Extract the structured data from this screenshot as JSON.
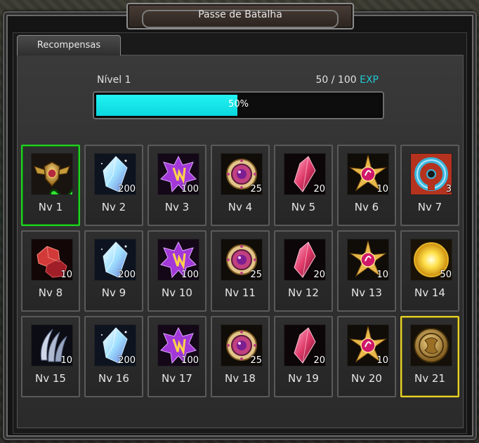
{
  "window": {
    "title": "Passe de Batalha"
  },
  "tabs": [
    {
      "label": "Recompensas"
    }
  ],
  "progress": {
    "level_label": "Nível 1",
    "exp_text": "50 / 100",
    "exp_unit": "EXP",
    "percent_label": "50%",
    "fraction": 0.5
  },
  "rewards": [
    {
      "label": "Nv 1",
      "qty": "",
      "icon": "winged-shield-badge-icon",
      "state": "claimed"
    },
    {
      "label": "Nv 2",
      "qty": "200",
      "icon": "crystal-shard-icon",
      "state": ""
    },
    {
      "label": "Nv 3",
      "qty": "100",
      "icon": "purple-star-rune-icon",
      "state": ""
    },
    {
      "label": "Nv 4",
      "qty": "25",
      "icon": "gold-ring-gem-icon",
      "state": ""
    },
    {
      "label": "Nv 5",
      "qty": "20",
      "icon": "pink-gem-icon",
      "state": ""
    },
    {
      "label": "Nv 6",
      "qty": "10",
      "icon": "star-compass-icon",
      "state": ""
    },
    {
      "label": "Nv 7",
      "qty": "3",
      "icon": "horseshoe-icon",
      "state": ""
    },
    {
      "label": "Nv 8",
      "qty": "10",
      "icon": "red-ore-icon",
      "state": ""
    },
    {
      "label": "Nv 9",
      "qty": "200",
      "icon": "crystal-shard-icon",
      "state": ""
    },
    {
      "label": "Nv 10",
      "qty": "100",
      "icon": "purple-star-rune-icon",
      "state": ""
    },
    {
      "label": "Nv 11",
      "qty": "25",
      "icon": "gold-ring-gem-icon",
      "state": ""
    },
    {
      "label": "Nv 12",
      "qty": "20",
      "icon": "pink-gem-icon",
      "state": ""
    },
    {
      "label": "Nv 13",
      "qty": "10",
      "icon": "star-compass-icon",
      "state": ""
    },
    {
      "label": "Nv 14",
      "qty": "50",
      "icon": "golden-orb-icon",
      "state": ""
    },
    {
      "label": "Nv 15",
      "qty": "10",
      "icon": "claw-icon",
      "state": ""
    },
    {
      "label": "Nv 16",
      "qty": "200",
      "icon": "crystal-shard-icon",
      "state": ""
    },
    {
      "label": "Nv 17",
      "qty": "100",
      "icon": "purple-star-rune-icon",
      "state": ""
    },
    {
      "label": "Nv 18",
      "qty": "25",
      "icon": "gold-ring-gem-icon",
      "state": ""
    },
    {
      "label": "Nv 19",
      "qty": "20",
      "icon": "pink-gem-icon",
      "state": ""
    },
    {
      "label": "Nv 20",
      "qty": "10",
      "icon": "star-compass-icon",
      "state": ""
    },
    {
      "label": "Nv 21",
      "qty": "",
      "icon": "gold-coin-icon",
      "state": "selected"
    }
  ],
  "colors": {
    "exp_accent": "#20c9d2",
    "progress_fill": "#22f3f3",
    "claimed_border": "#24d024",
    "selected_border": "#e6d22a"
  }
}
